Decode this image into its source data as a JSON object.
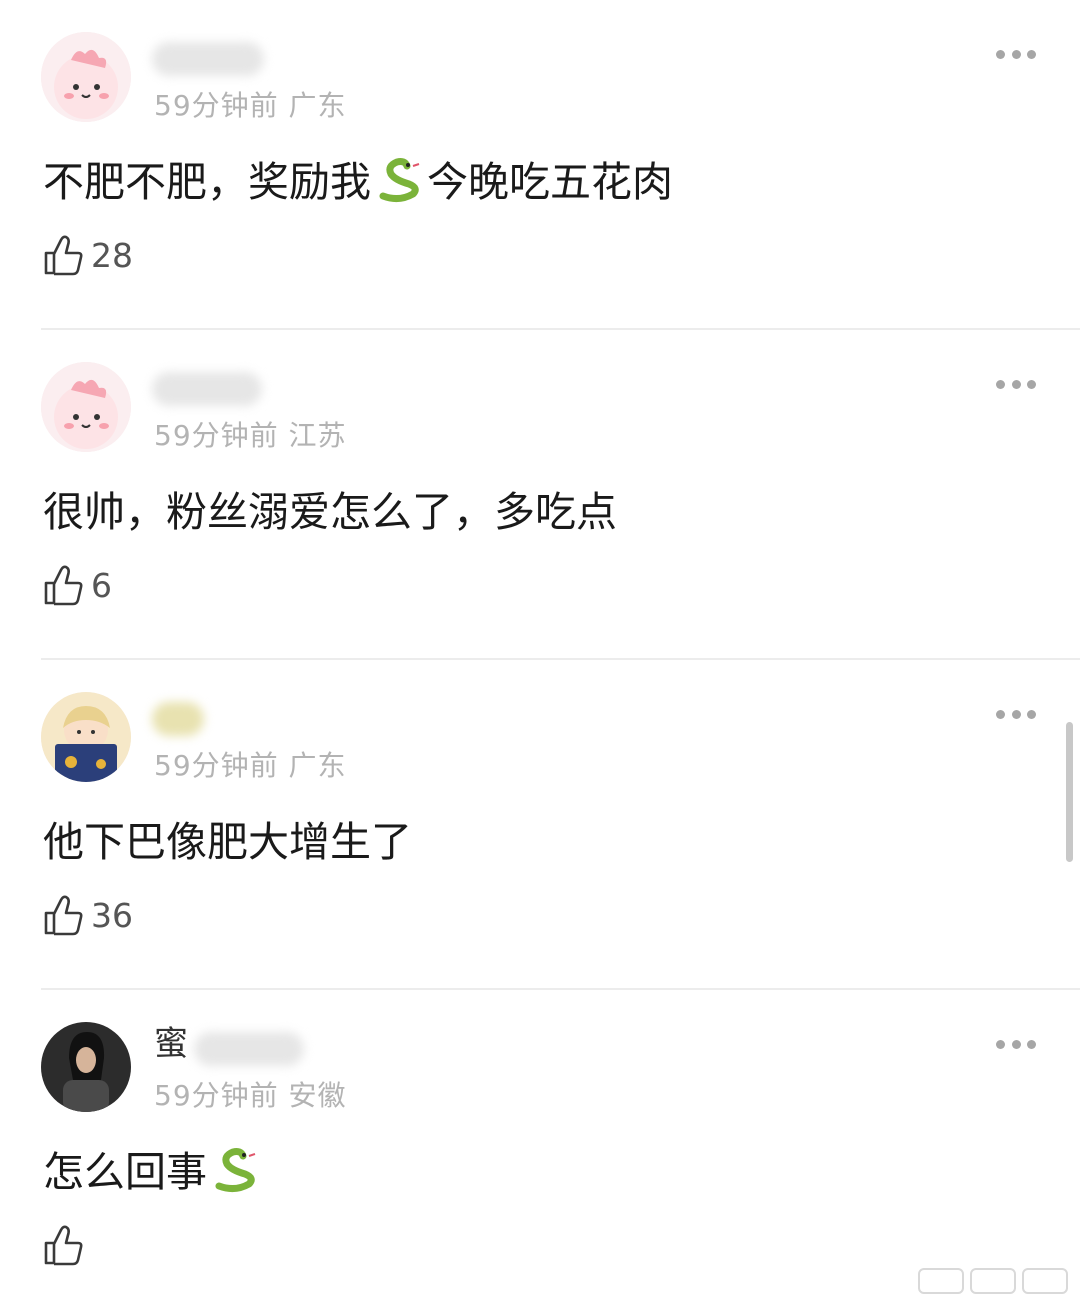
{
  "comments": [
    {
      "username": "",
      "time": "59分钟前",
      "location": "广东",
      "text_before": "不肥不肥，奖励我",
      "emoji": "snake-emoji",
      "text_after": "今晚吃五花肉",
      "likes": "28"
    },
    {
      "username": "",
      "time": "59分钟前",
      "location": "江苏",
      "text_before": "很帅，粉丝溺爱怎么了，多吃点",
      "text_after": "",
      "likes": "6"
    },
    {
      "username": "",
      "time": "59分钟前",
      "location": "广东",
      "text_before": "他下巴像肥大增生了",
      "text_after": "",
      "likes": "36"
    },
    {
      "username": "蜜",
      "time": "59分钟前",
      "location": "安徽",
      "text_before": "怎么回事",
      "emoji": "snake-emoji",
      "text_after": "",
      "likes": ""
    }
  ],
  "colors": {
    "meta": "#b3b3b3",
    "divider": "#ececec",
    "text": "#1a1a1a",
    "snake": "#7bb33a"
  },
  "icons": {
    "more": "more-dots-icon",
    "like": "thumbs-up-icon"
  }
}
